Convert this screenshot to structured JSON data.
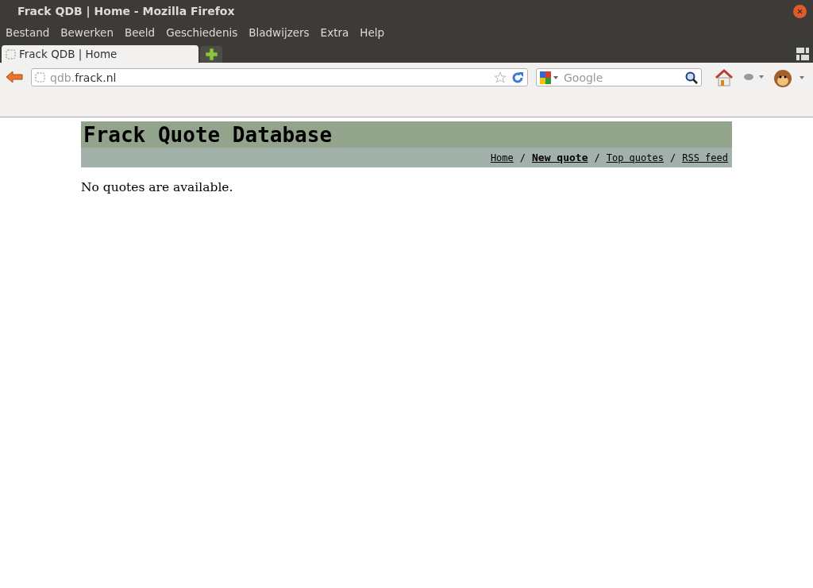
{
  "window": {
    "title": "Frack QDB | Home - Mozilla Firefox"
  },
  "menu": [
    "Bestand",
    "Bewerken",
    "Beeld",
    "Geschiedenis",
    "Bladwijzers",
    "Extra",
    "Help"
  ],
  "tabs": [
    {
      "label": "Frack QDB | Home",
      "selected": true
    }
  ],
  "address": {
    "value_dim": "qdb.",
    "value": "frack.nl"
  },
  "search": {
    "placeholder": "Google"
  },
  "page": {
    "title": "Frack Quote Database",
    "nav": [
      {
        "label": "Home",
        "selected": false
      },
      {
        "label": "New quote",
        "selected": true
      },
      {
        "label": "Top quotes",
        "selected": false
      },
      {
        "label": "RSS feed",
        "selected": false
      }
    ],
    "separators": [
      "/",
      "/",
      "/"
    ],
    "message": "No quotes are available."
  }
}
